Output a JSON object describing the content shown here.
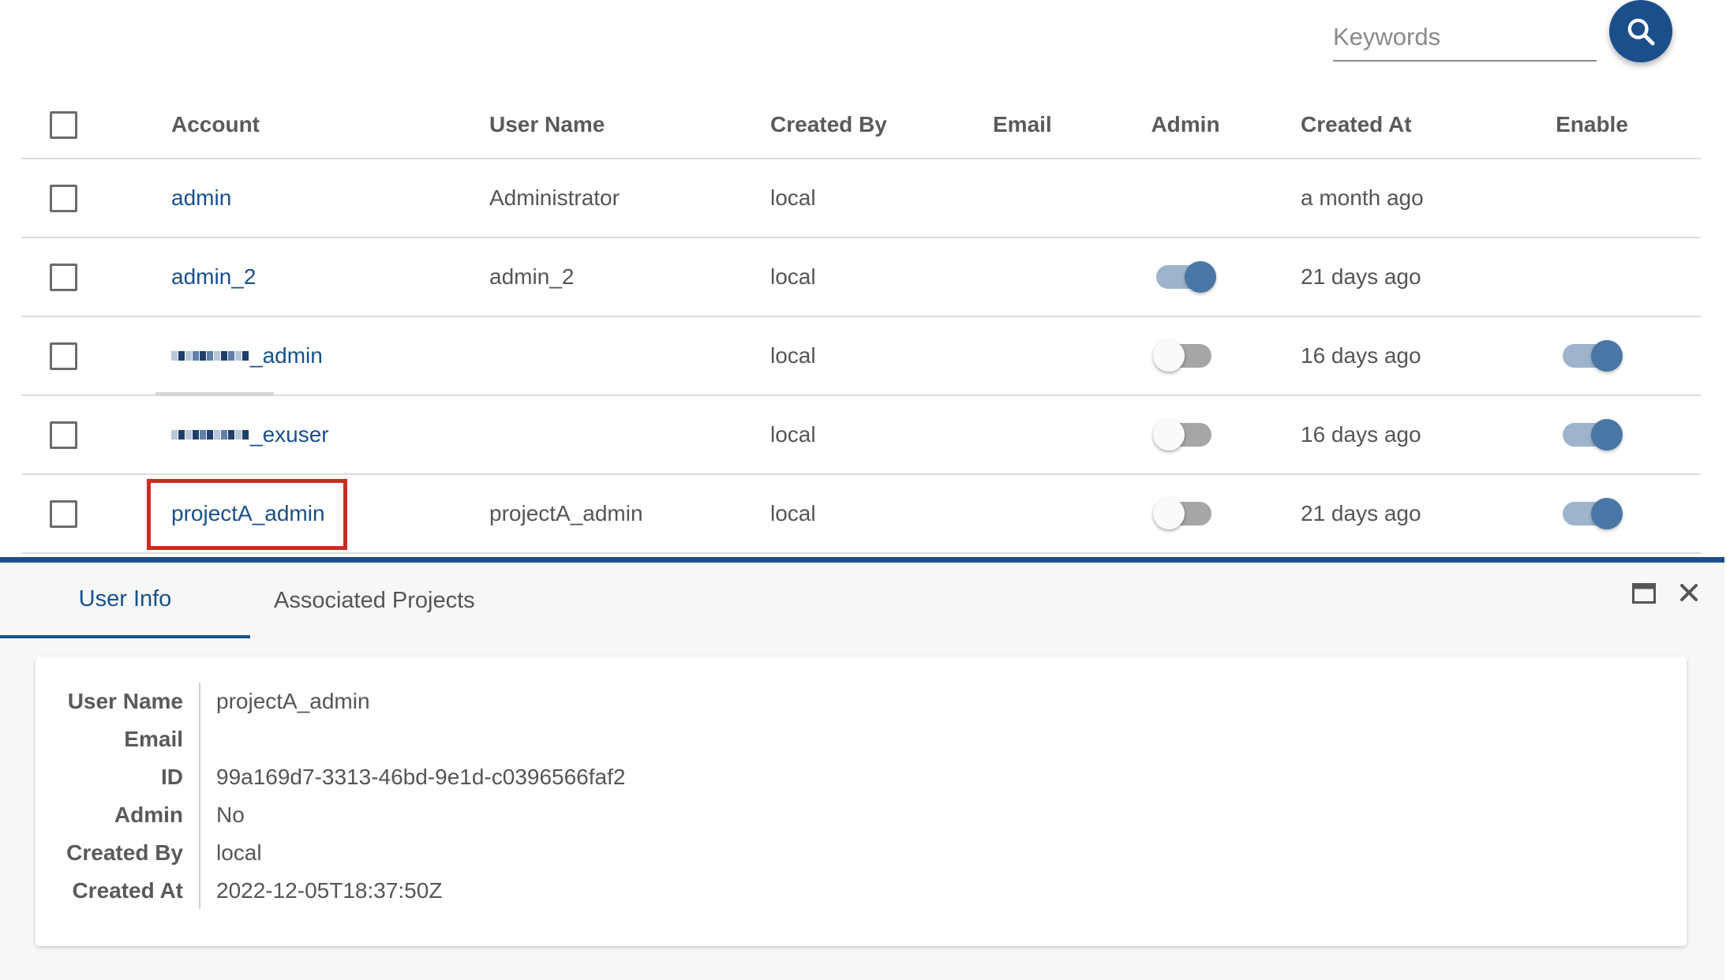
{
  "search": {
    "placeholder": "Keywords",
    "value": ""
  },
  "table": {
    "columns": {
      "account": "Account",
      "user_name": "User Name",
      "created_by": "Created By",
      "email": "Email",
      "admin": "Admin",
      "created_at": "Created At",
      "enable": "Enable"
    },
    "rows": [
      {
        "account": "admin",
        "user_name": "Administrator",
        "created_by": "local",
        "email": "",
        "admin": null,
        "created_at": "a month ago",
        "enable": null
      },
      {
        "account": "admin_2",
        "user_name": "admin_2",
        "created_by": "local",
        "email": "",
        "admin": true,
        "created_at": "21 days ago",
        "enable": null
      },
      {
        "account": "_admin",
        "user_name": "",
        "created_by": "local",
        "email": "",
        "admin": false,
        "created_at": "16 days ago",
        "enable": true
      },
      {
        "account": "_exuser",
        "user_name": "",
        "created_by": "local",
        "email": "",
        "admin": false,
        "created_at": "16 days ago",
        "enable": true
      },
      {
        "account": "projectA_admin",
        "user_name": "projectA_admin",
        "created_by": "local",
        "email": "",
        "admin": false,
        "created_at": "21 days ago",
        "enable": true
      }
    ]
  },
  "panel": {
    "tabs": [
      "User Info",
      "Associated Projects"
    ],
    "active_tab": "User Info",
    "info": {
      "labels": {
        "user_name": "User Name",
        "email": "Email",
        "id": "ID",
        "admin": "Admin",
        "created_by": "Created By",
        "created_at": "Created At"
      },
      "values": {
        "user_name": "projectA_admin",
        "email": "",
        "id": "99a169d7-3313-46bd-9e1d-c0396566faf2",
        "admin": "No",
        "created_by": "local",
        "created_at": "2022-12-05T18:37:50Z"
      }
    },
    "icons": [
      "maximize-icon",
      "close-icon"
    ]
  },
  "colors": {
    "primary": "#1a4f8b",
    "highlight": "#cc2b21",
    "toggle_on_knob": "#4a77a5",
    "toggle_on_track": "#9eb4cc"
  }
}
